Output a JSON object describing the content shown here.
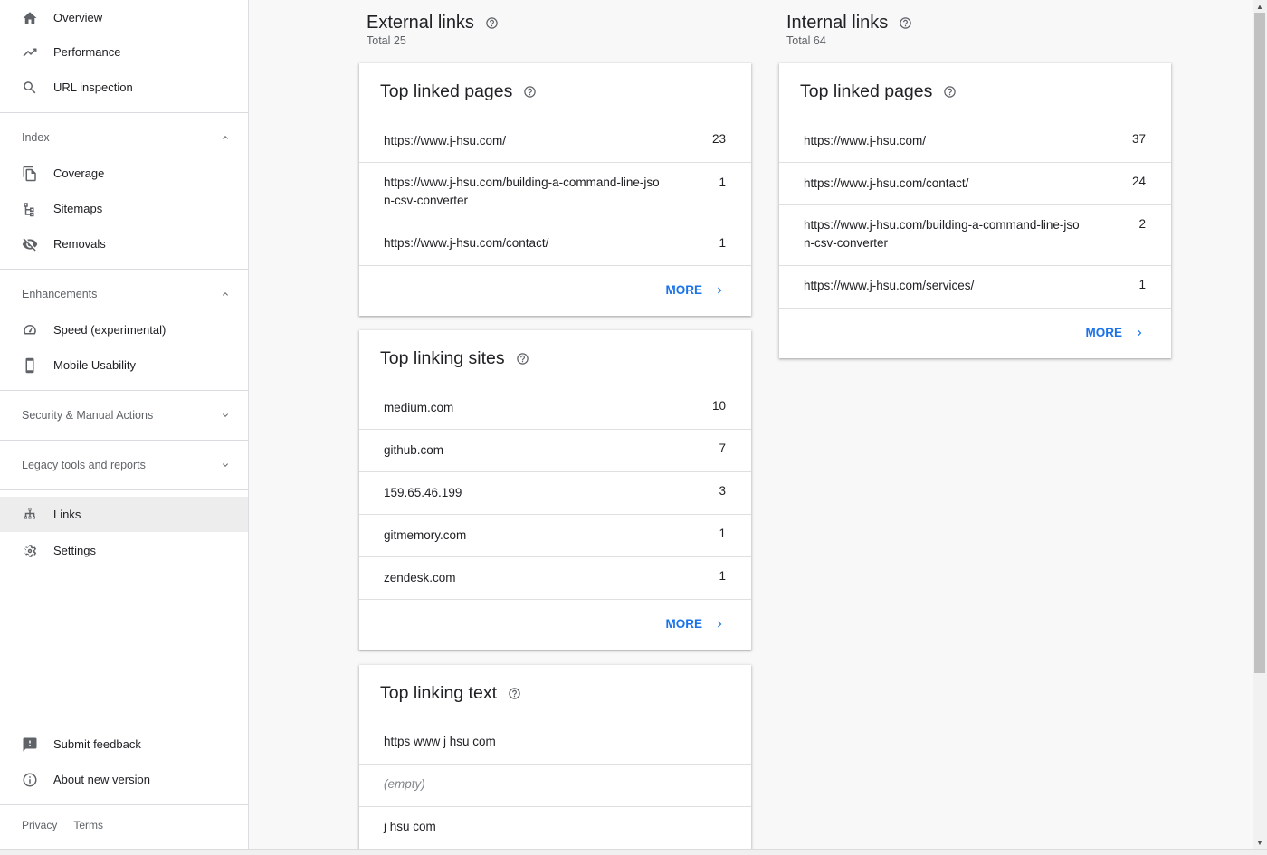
{
  "sidebar": {
    "top_items": [
      {
        "label": "Overview",
        "icon": "home-icon"
      },
      {
        "label": "Performance",
        "icon": "trending-up-icon"
      },
      {
        "label": "URL inspection",
        "icon": "search-icon"
      }
    ],
    "index_section": {
      "label": "Index",
      "expanded": true,
      "items": [
        {
          "label": "Coverage",
          "icon": "coverage-icon"
        },
        {
          "label": "Sitemaps",
          "icon": "sitemap-icon"
        },
        {
          "label": "Removals",
          "icon": "eye-off-icon"
        }
      ]
    },
    "enhancements_section": {
      "label": "Enhancements",
      "expanded": true,
      "items": [
        {
          "label": "Speed (experimental)",
          "icon": "speedometer-icon"
        },
        {
          "label": "Mobile Usability",
          "icon": "phone-icon"
        }
      ]
    },
    "security_section": {
      "label": "Security & Manual Actions",
      "expanded": false
    },
    "legacy_section": {
      "label": "Legacy tools and reports",
      "expanded": false
    },
    "links_item": {
      "label": "Links",
      "icon": "links-icon",
      "active": true
    },
    "settings_item": {
      "label": "Settings",
      "icon": "gear-icon"
    },
    "feedback_item": {
      "label": "Submit feedback",
      "icon": "feedback-icon"
    },
    "about_item": {
      "label": "About new version",
      "icon": "info-icon"
    },
    "footer": {
      "privacy": "Privacy",
      "terms": "Terms"
    }
  },
  "external": {
    "title": "External links",
    "total": "Total 25",
    "top_linked_pages": {
      "title": "Top linked pages",
      "rows": [
        {
          "text": "https://www.j-hsu.com/",
          "value": "23"
        },
        {
          "text": "https://www.j-hsu.com/building-a-command-line-json-csv-converter",
          "value": "1"
        },
        {
          "text": "https://www.j-hsu.com/contact/",
          "value": "1"
        }
      ],
      "more": "MORE"
    },
    "top_linking_sites": {
      "title": "Top linking sites",
      "rows": [
        {
          "text": "medium.com",
          "value": "10"
        },
        {
          "text": "github.com",
          "value": "7"
        },
        {
          "text": "159.65.46.199",
          "value": "3"
        },
        {
          "text": "gitmemory.com",
          "value": "1"
        },
        {
          "text": "zendesk.com",
          "value": "1"
        }
      ],
      "more": "MORE"
    },
    "top_linking_text": {
      "title": "Top linking text",
      "rows": [
        {
          "text": "https www j hsu com"
        },
        {
          "text": "(empty)"
        },
        {
          "text": "j hsu com"
        }
      ]
    }
  },
  "internal": {
    "title": "Internal links",
    "total": "Total 64",
    "top_linked_pages": {
      "title": "Top linked pages",
      "rows": [
        {
          "text": "https://www.j-hsu.com/",
          "value": "37"
        },
        {
          "text": "https://www.j-hsu.com/contact/",
          "value": "24"
        },
        {
          "text": "https://www.j-hsu.com/building-a-command-line-json-csv-converter",
          "value": "2"
        },
        {
          "text": "https://www.j-hsu.com/services/",
          "value": "1"
        }
      ],
      "more": "MORE"
    }
  },
  "colors": {
    "accent": "#1a73e8",
    "icon": "#5f6368",
    "active_bg": "#ededed"
  }
}
